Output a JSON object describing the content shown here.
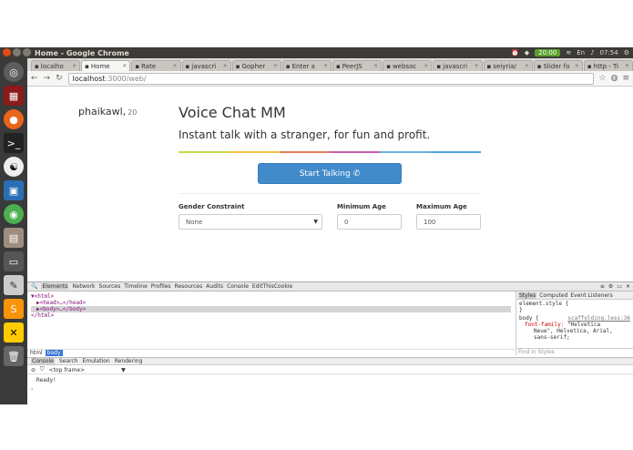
{
  "window": {
    "title": "Home - Google Chrome"
  },
  "tray": {
    "battery": "20:00",
    "lang": "En",
    "clock": "07:54"
  },
  "launcher": [
    "dash-icon",
    "monitor-icon",
    "firefox-icon",
    "terminal-icon",
    "yin-yang-icon",
    "package-icon",
    "chrome-icon",
    "files-icon",
    "drive-icon",
    "editor-icon",
    "sublime-icon",
    "crossover-icon",
    "trash-icon"
  ],
  "tabs": [
    {
      "label": "localho"
    },
    {
      "label": "Home",
      "active": true
    },
    {
      "label": "Rate"
    },
    {
      "label": "javascri"
    },
    {
      "label": "Gopher"
    },
    {
      "label": "Enter a"
    },
    {
      "label": "PeerJS"
    },
    {
      "label": "websoc"
    },
    {
      "label": "javascri"
    },
    {
      "label": "seiyria/"
    },
    {
      "label": "Slider fo"
    },
    {
      "label": "http - Ti"
    }
  ],
  "address": {
    "host": "localhost",
    "path": ":3000/web/"
  },
  "page": {
    "username": "phaikawl,",
    "age": "20",
    "headline": "Voice Chat MM",
    "tagline": "Instant talk with a stranger, for fun and profit.",
    "start_button": "Start Talking",
    "gender_label": "Gender Constraint",
    "gender_value": "None",
    "min_age_label": "Minimum Age",
    "min_age_value": "0",
    "max_age_label": "Maximum Age",
    "max_age_value": "100"
  },
  "rainbow_colors": [
    "#cbd64c",
    "#f6c244",
    "#e77f5b",
    "#c95fa8",
    "#6cb3e0",
    "#4aa3df"
  ],
  "devtools": {
    "tabs": [
      "Elements",
      "Network",
      "Sources",
      "Timeline",
      "Profiles",
      "Resources",
      "Audits",
      "Console",
      "EditThisCookie"
    ],
    "dom": [
      "▼<html>",
      "▶<head>…</head>",
      "▶<body>…</body>",
      "</html>"
    ],
    "style_tabs": [
      "Styles",
      "Computed",
      "Event Listeners"
    ],
    "style_rules": {
      "element": "element.style {",
      "element_close": "}",
      "body_selector": "body {",
      "body_source": "scaffolding.less:36",
      "prop": "font-family:",
      "value1": "\"Helvetica",
      "value2": "Neue\", Helvetica, Arial,",
      "value3": "sans-serif;"
    },
    "find_placeholder": "Find in Styles",
    "crumbs": [
      "html",
      "body"
    ],
    "drawer_tabs": [
      "Console",
      "Search",
      "Emulation",
      "Rendering"
    ],
    "frame": "<top frame>",
    "console_output": "Ready!",
    "prompt": "›"
  }
}
